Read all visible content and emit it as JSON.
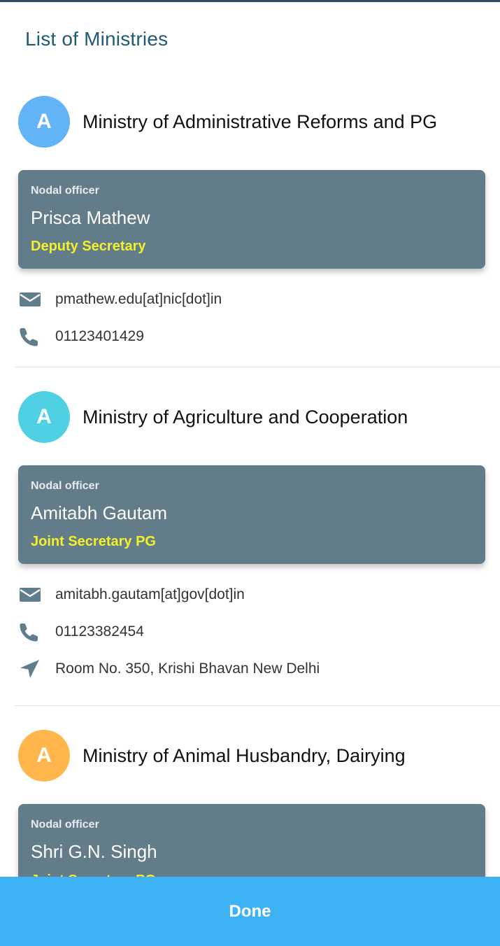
{
  "page": {
    "title": "List of Ministries"
  },
  "ministries": [
    {
      "avatar_letter": "A",
      "avatar_color": "#63b4f7",
      "name": "Ministry of Administrative Reforms and PG",
      "card_label": "Nodal officer",
      "officer_name": "Prisca Mathew",
      "officer_role": "Deputy Secretary",
      "email": "pmathew.edu[at]nic[dot]in",
      "phone": "01123401429"
    },
    {
      "avatar_letter": "A",
      "avatar_color": "#4fd0e3",
      "name": "Ministry of Agriculture and Cooperation",
      "card_label": "Nodal officer",
      "officer_name": "Amitabh Gautam",
      "officer_role": "Joint Secretary PG",
      "email": "amitabh.gautam[at]gov[dot]in",
      "phone": "01123382454",
      "address": "Room No. 350, Krishi Bhavan New Delhi"
    },
    {
      "avatar_letter": "A",
      "avatar_color": "#ffb74d",
      "name": "Ministry of Animal Husbandry, Dairying",
      "card_label": "Nodal officer",
      "officer_name": "Shri G.N. Singh",
      "officer_role": "Joint Secretary PG"
    }
  ],
  "icons": {
    "email": "email-icon",
    "phone": "phone-icon",
    "location": "navigation-arrow-icon"
  },
  "footer": {
    "done_label": "Done",
    "bar_color": "#3db3f5"
  }
}
